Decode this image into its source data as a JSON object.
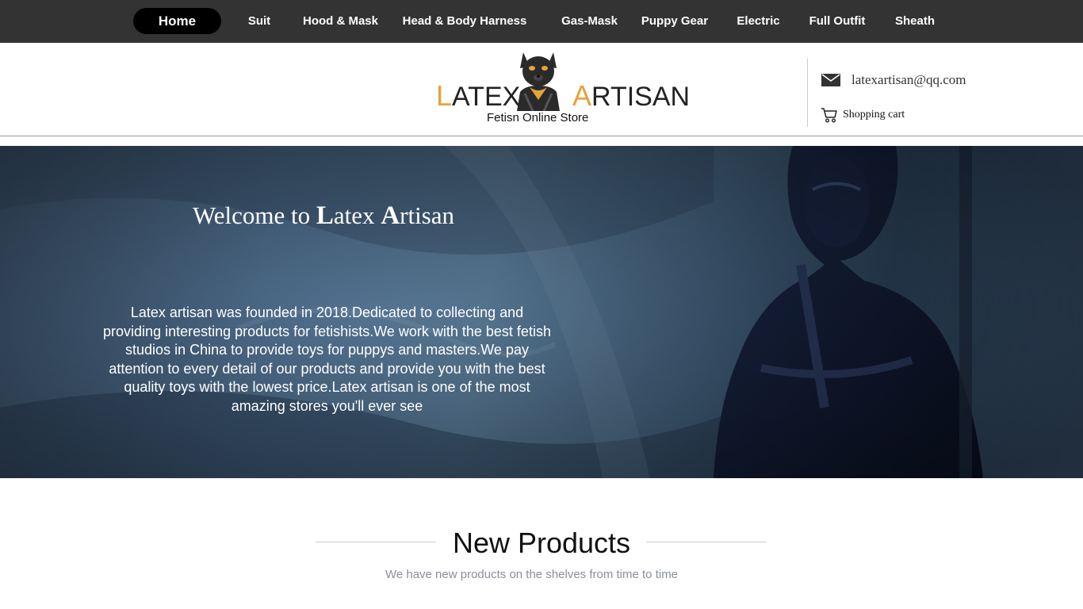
{
  "nav": {
    "items": [
      {
        "label": "Home",
        "active": true
      },
      {
        "label": "Suit"
      },
      {
        "label": "Hood & Mask"
      },
      {
        "label": "Head & Body Harness"
      },
      {
        "label": "Gas-Mask"
      },
      {
        "label": "Puppy Gear"
      },
      {
        "label": "Electric"
      },
      {
        "label": "Full Outfit"
      },
      {
        "label": "Sheath"
      }
    ]
  },
  "header": {
    "logo": {
      "word1_cap": "L",
      "word1_rest": "ATEX",
      "word2_cap": "A",
      "word2_rest": "RTISAN",
      "tagline": "Fetisn Online Store",
      "mascot_icon": "latex-puppy-mascot-icon"
    },
    "email": {
      "icon": "mail-icon",
      "text": "latexartisan@qq.com"
    },
    "cart": {
      "icon": "shopping-cart-icon",
      "text": "Shopping cart"
    }
  },
  "hero": {
    "title_prefix": "Welcome to ",
    "title_l_cap": "L",
    "title_l_rest": "atex ",
    "title_a_cap": "A",
    "title_a_rest": "rtisan",
    "body": "Latex artisan was founded in 2018.Dedicated to collecting and providing interesting products for fetishists.We work with the best fetish studios in China to provide toys for puppys and masters.We pay attention to every detail of our products and provide you with the best quality toys with the lowest price.Latex artisan is one of the most amazing stores you'll ever see"
  },
  "new_products": {
    "title": "New Products",
    "subtitle": "We have new products on the shelves from time to time"
  },
  "colors": {
    "nav_bg": "#333333",
    "nav_active_bg": "#000000",
    "logo_accent": "#e8a23a",
    "hero_blue": "#4e6d8c",
    "subtitle_gray": "#8a8f99"
  }
}
